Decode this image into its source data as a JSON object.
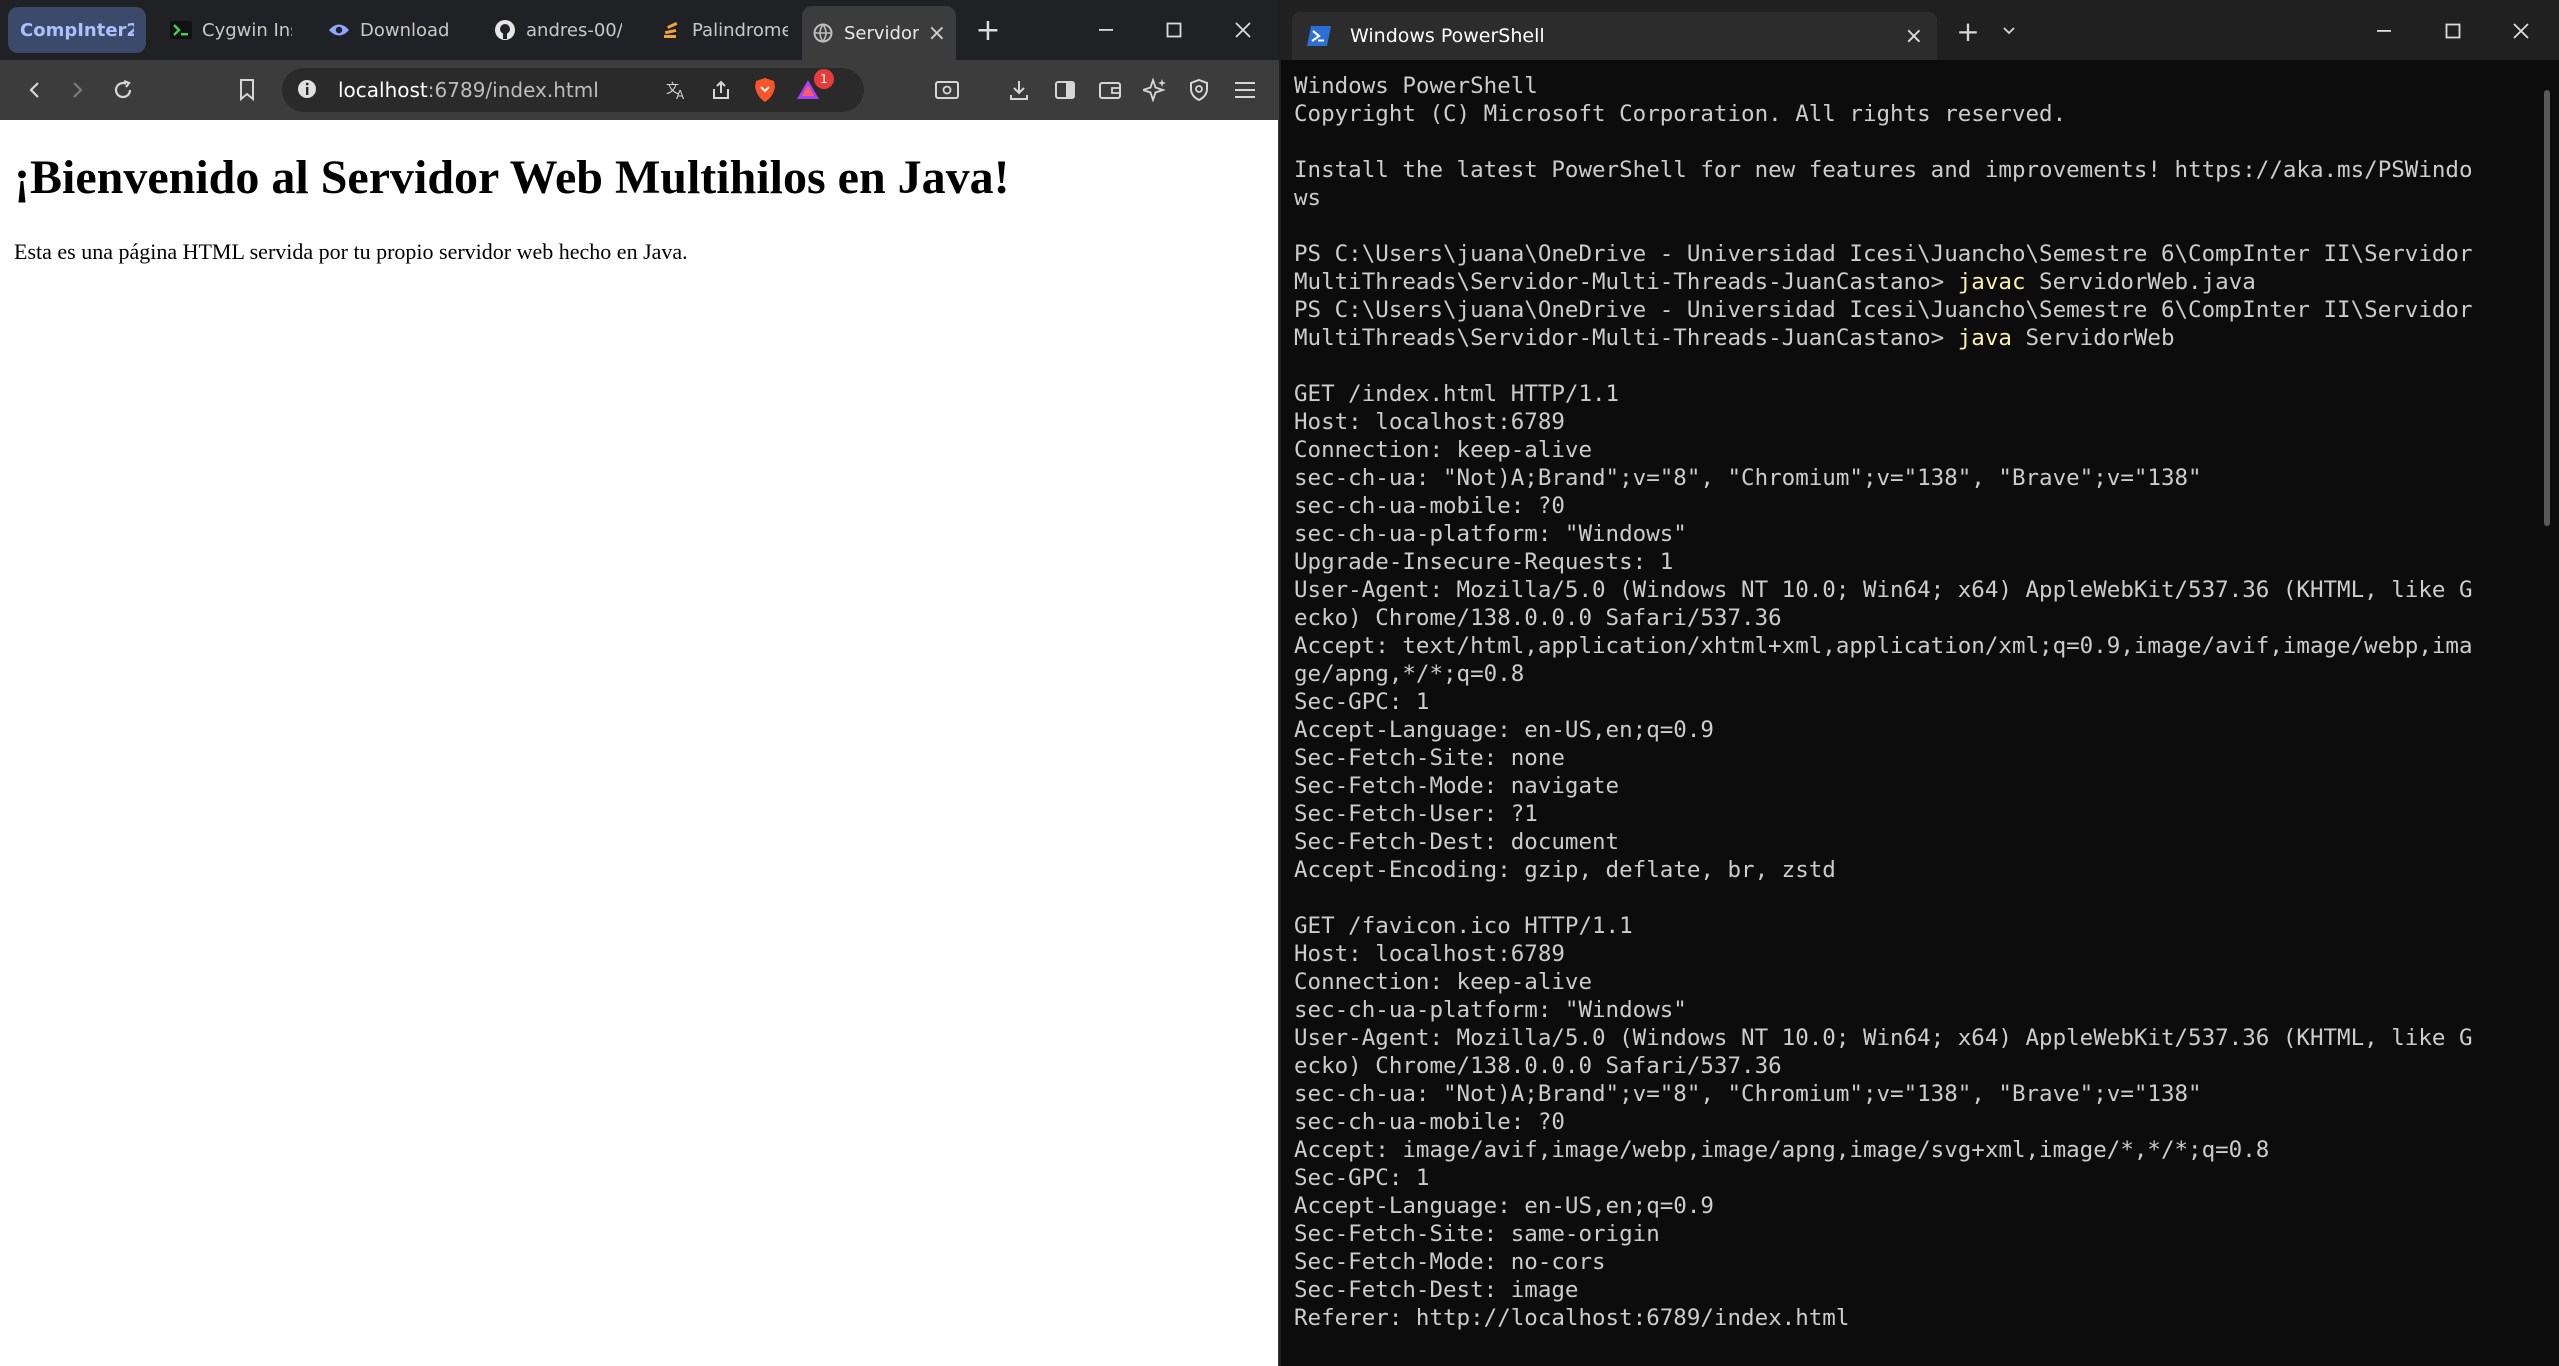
{
  "browser": {
    "tab_group_label": "CompInter2",
    "tabs": [
      {
        "title": "Cygwin Ins",
        "icon": "terminal-icon"
      },
      {
        "title": "Download",
        "icon": "eye-icon"
      },
      {
        "title": "andres-00/",
        "icon": "github-icon"
      },
      {
        "title": "Palindrome",
        "icon": "stack-icon"
      },
      {
        "title": "Servidor",
        "icon": "globe-icon",
        "active": true
      }
    ],
    "url_host": "localhost",
    "url_path": ":6789/index.html",
    "notification_badge": "1",
    "page": {
      "heading": "¡Bienvenido al Servidor Web Multihilos en Java!",
      "paragraph": "Esta es una página HTML servida por tu propio servidor web hecho en Java."
    }
  },
  "terminal": {
    "tab_title": "Windows PowerShell",
    "lines": [
      [
        "Windows PowerShell",
        ""
      ],
      [
        "Copyright (C) Microsoft Corporation. All rights reserved.",
        ""
      ],
      [
        "",
        ""
      ],
      [
        "Install the latest PowerShell for new features and improvements! https://aka.ms/PSWindo",
        ""
      ],
      [
        "ws",
        ""
      ],
      [
        "",
        ""
      ],
      [
        "PS C:\\Users\\juana\\OneDrive - Universidad Icesi\\Juancho\\Semestre 6\\CompInter II\\Servidor",
        ""
      ],
      [
        "MultiThreads\\Servidor-Multi-Threads-JuanCastano> ",
        "javac",
        " ServidorWeb.java"
      ],
      [
        "PS C:\\Users\\juana\\OneDrive - Universidad Icesi\\Juancho\\Semestre 6\\CompInter II\\Servidor",
        ""
      ],
      [
        "MultiThreads\\Servidor-Multi-Threads-JuanCastano> ",
        "java",
        " ServidorWeb"
      ],
      [
        "",
        ""
      ],
      [
        "GET /index.html HTTP/1.1",
        ""
      ],
      [
        "Host: localhost:6789",
        ""
      ],
      [
        "Connection: keep-alive",
        ""
      ],
      [
        "sec-ch-ua: \"Not)A;Brand\";v=\"8\", \"Chromium\";v=\"138\", \"Brave\";v=\"138\"",
        ""
      ],
      [
        "sec-ch-ua-mobile: ?0",
        ""
      ],
      [
        "sec-ch-ua-platform: \"Windows\"",
        ""
      ],
      [
        "Upgrade-Insecure-Requests: 1",
        ""
      ],
      [
        "User-Agent: Mozilla/5.0 (Windows NT 10.0; Win64; x64) AppleWebKit/537.36 (KHTML, like G",
        ""
      ],
      [
        "ecko) Chrome/138.0.0.0 Safari/537.36",
        ""
      ],
      [
        "Accept: text/html,application/xhtml+xml,application/xml;q=0.9,image/avif,image/webp,ima",
        ""
      ],
      [
        "ge/apng,*/*;q=0.8",
        ""
      ],
      [
        "Sec-GPC: 1",
        ""
      ],
      [
        "Accept-Language: en-US,en;q=0.9",
        ""
      ],
      [
        "Sec-Fetch-Site: none",
        ""
      ],
      [
        "Sec-Fetch-Mode: navigate",
        ""
      ],
      [
        "Sec-Fetch-User: ?1",
        ""
      ],
      [
        "Sec-Fetch-Dest: document",
        ""
      ],
      [
        "Accept-Encoding: gzip, deflate, br, zstd",
        ""
      ],
      [
        "",
        ""
      ],
      [
        "GET /favicon.ico HTTP/1.1",
        ""
      ],
      [
        "Host: localhost:6789",
        ""
      ],
      [
        "Connection: keep-alive",
        ""
      ],
      [
        "sec-ch-ua-platform: \"Windows\"",
        ""
      ],
      [
        "User-Agent: Mozilla/5.0 (Windows NT 10.0; Win64; x64) AppleWebKit/537.36 (KHTML, like G",
        ""
      ],
      [
        "ecko) Chrome/138.0.0.0 Safari/537.36",
        ""
      ],
      [
        "sec-ch-ua: \"Not)A;Brand\";v=\"8\", \"Chromium\";v=\"138\", \"Brave\";v=\"138\"",
        ""
      ],
      [
        "sec-ch-ua-mobile: ?0",
        ""
      ],
      [
        "Accept: image/avif,image/webp,image/apng,image/svg+xml,image/*,*/*;q=0.8",
        ""
      ],
      [
        "Sec-GPC: 1",
        ""
      ],
      [
        "Accept-Language: en-US,en;q=0.9",
        ""
      ],
      [
        "Sec-Fetch-Site: same-origin",
        ""
      ],
      [
        "Sec-Fetch-Mode: no-cors",
        ""
      ],
      [
        "Sec-Fetch-Dest: image",
        ""
      ],
      [
        "Referer: http://localhost:6789/index.html",
        ""
      ]
    ]
  },
  "colors": {
    "browser_chrome": "#3c3c3c",
    "tab_strip": "#202124",
    "tab_group": "#3b4a6b",
    "brave_orange": "#fb542b",
    "terminal_bg": "#0c0c0c",
    "terminal_text": "#cccccc",
    "command_yellow": "#f9f1a5"
  }
}
